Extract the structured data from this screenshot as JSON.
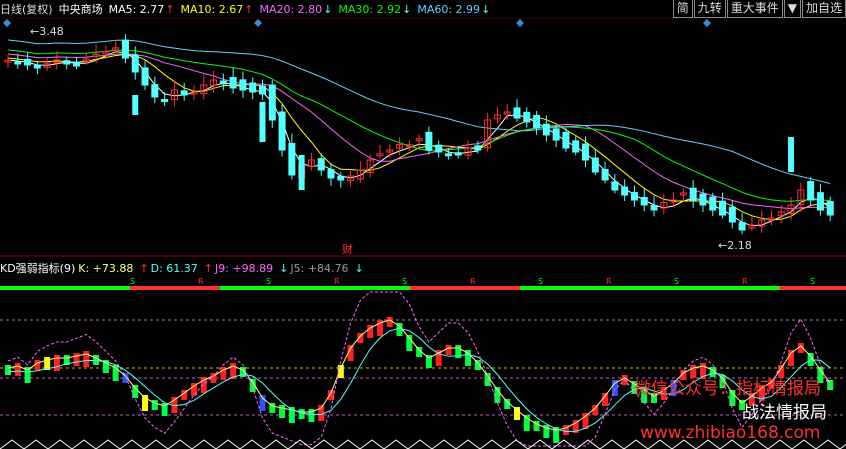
{
  "header": {
    "period": "日线(复权)",
    "stock": "中央商场",
    "ma": [
      {
        "label": "MA5: 2.77",
        "arrow": "↑",
        "color": "#ffffff"
      },
      {
        "label": "MA10: 2.67",
        "arrow": "↑",
        "color": "#ffff00"
      },
      {
        "label": "MA20: 2.80",
        "arrow": "↓",
        "color": "#ff66ff"
      },
      {
        "label": "MA30: 2.92",
        "arrow": "↓",
        "color": "#00ff00"
      },
      {
        "label": "MA60: 2.99",
        "arrow": "↓",
        "color": "#66ccff"
      }
    ]
  },
  "toolbar": {
    "simple": "简",
    "nine": "九转",
    "events": "重大事件",
    "dropdown": "▼",
    "add": "加自选"
  },
  "price_chart": {
    "high_label": "3.48",
    "low_label": "2.18",
    "cai_label": "财",
    "colors": {
      "up": "#ff3232",
      "down": "#54ffff",
      "ma5": "#ffffff",
      "ma10": "#ffff00",
      "ma20": "#ff66ff",
      "ma30": "#00ff00",
      "ma60": "#66ccff"
    }
  },
  "kd_header": {
    "name": "KD强弱指标(9)",
    "k": "K: +73.88",
    "k_arrow": "↑",
    "d": "D: 61.37",
    "d_arrow": "↑",
    "j": "J9: +98.89",
    "j_arrow": "↓",
    "j5": "J5: +84.76",
    "j5_arrow": "↓"
  },
  "kd_ribbon_letters": [
    "S",
    "R",
    "S",
    "R",
    "S",
    "R",
    "S",
    "R",
    "S",
    "R",
    "S"
  ],
  "watermark": {
    "line1": "微信公众号：指标情报局",
    "line2": "战法情报局",
    "url": "www.zhibiao168.com"
  }
}
